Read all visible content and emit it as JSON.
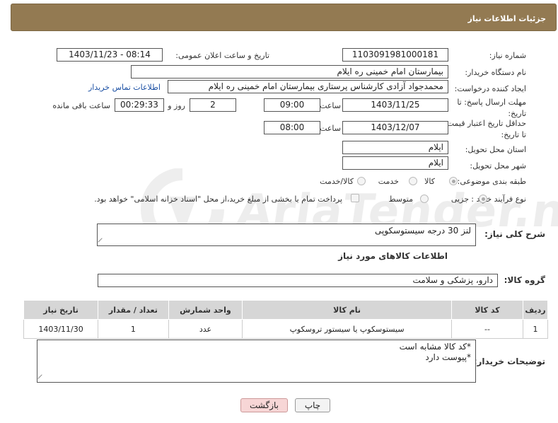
{
  "header": {
    "title": "جزئیات اطلاعات نیاز"
  },
  "watermark": "AriaTender.neT",
  "form": {
    "need_number_label": "شماره نیاز:",
    "need_number": "1103091981000181",
    "announce_label": "تاریخ و ساعت اعلان عمومی:",
    "announce_value": "1403/11/23 - 08:14",
    "buyer_label": "نام دستگاه خریدار:",
    "buyer_value": "بیمارستان امام خمینی  ره  ایلام",
    "creator_label": "ایجاد کننده درخواست:",
    "creator_value": "محمدجواد آزادی کارشناس پرستاری بیمارستان امام خمینی  ره  ایلام",
    "contact_link": "اطلاعات تماس خریدار",
    "deadline_label": "مهلت ارسال پاسخ: تا تاریخ:",
    "deadline_date": "1403/11/25",
    "time_label": "ساعت",
    "deadline_time": "09:00",
    "days_value": "2",
    "days_label": "روز و",
    "remaining_value": "00:29:33",
    "remaining_label": "ساعت باقی مانده",
    "min_price_label": "حداقل تاریخ اعتبار قیمت: تا تاریخ:",
    "min_price_date": "1403/12/07",
    "min_price_time": "08:00",
    "province_label": "استان محل تحویل:",
    "province_value": "ایلام",
    "city_label": "شهر محل تحویل:",
    "city_value": "ایلام",
    "category_label": "طبقه بندی موضوعی:",
    "category_options": [
      "کالا",
      "خدمت",
      "کالا/خدمت"
    ],
    "process_label": "نوع فرآیند خرید :",
    "process_options": [
      "جزیی",
      "متوسط"
    ],
    "payment_note": "پرداخت تمام یا بخشی از مبلغ خرید،از محل \"اسناد خزانه اسلامی\" خواهد بود."
  },
  "description": {
    "label": "شرح کلی نیاز:",
    "value": "لنز 30 درجه سیستوسکوپی"
  },
  "goods_section_title": "اطلاعات کالاهای مورد نیاز",
  "goods_group": {
    "label": "گروه کالا:",
    "value": "دارو، پزشکی و سلامت"
  },
  "table": {
    "headers": [
      "ردیف",
      "کد کالا",
      "نام کالا",
      "واحد شمارش",
      "تعداد / مقدار",
      "تاریخ نیاز"
    ],
    "rows": [
      [
        "1",
        "--",
        "سیستوسکوپ یا سیستور تروسکوپ",
        "عدد",
        "1",
        "1403/11/30"
      ]
    ]
  },
  "buyer_notes": {
    "label": "توضیحات خریدار:",
    "line1": "*کد کالا مشابه است",
    "line2": "*پیوست دارد"
  },
  "buttons": {
    "print": "چاپ",
    "back": "بازگشت"
  }
}
